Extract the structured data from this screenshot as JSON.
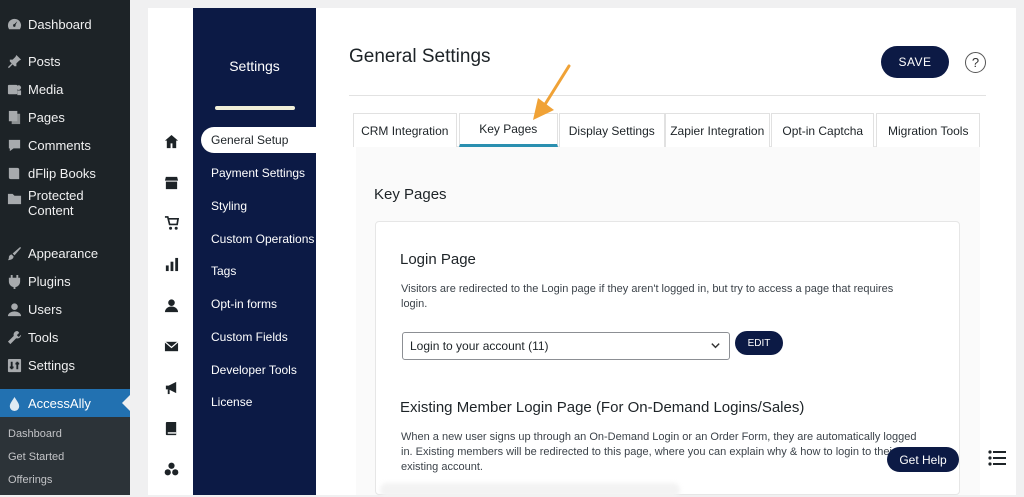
{
  "wp_menu": {
    "items": [
      {
        "label": "Dashboard",
        "icon": "dashboard-icon"
      },
      {
        "label": "Posts",
        "icon": "pin-icon"
      },
      {
        "label": "Media",
        "icon": "media-icon"
      },
      {
        "label": "Pages",
        "icon": "pages-icon"
      },
      {
        "label": "Comments",
        "icon": "comments-icon"
      },
      {
        "label": "dFlip Books",
        "icon": "book-icon"
      },
      {
        "label": "Protected Content",
        "icon": "folder-icon"
      },
      {
        "label": "Appearance",
        "icon": "brush-icon"
      },
      {
        "label": "Plugins",
        "icon": "plugin-icon"
      },
      {
        "label": "Users",
        "icon": "user-icon"
      },
      {
        "label": "Tools",
        "icon": "wrench-icon"
      },
      {
        "label": "Settings",
        "icon": "settings-icon"
      },
      {
        "label": "AccessAlly",
        "icon": "drop-icon"
      }
    ],
    "submenu": [
      "Dashboard",
      "Get Started",
      "Offerings"
    ]
  },
  "settings_nav": {
    "title": "Settings",
    "items": [
      "General Setup",
      "Payment Settings",
      "Styling",
      "Custom Operations",
      "Tags",
      "Opt-in forms",
      "Custom Fields",
      "Developer Tools",
      "License"
    ]
  },
  "header": {
    "title": "General Settings",
    "save_label": "SAVE",
    "help_label": "?"
  },
  "tabs": [
    "CRM Integration",
    "Key Pages",
    "Display Settings",
    "Zapier Integration",
    "Opt-in Captcha",
    "Migration Tools"
  ],
  "main": {
    "section_title": "Key Pages",
    "login": {
      "title": "Login Page",
      "description_line1": "Visitors are redirected to the Login page if they aren't logged in, but try to access a page that requires",
      "description_line2": "login.",
      "selected": "Login to your account (11)",
      "edit_label": "EDIT"
    },
    "existing": {
      "title": "Existing Member Login Page (For On-Demand Logins/Sales)",
      "description_line1": "When a new user signs up through an On-Demand Login or an Order Form, they are automatically logged",
      "description_line2": "in. Existing members will be redirected to this page, where you can explain why & how to login to their",
      "description_line3": "existing account."
    }
  },
  "help_widget": {
    "label": "Get Help"
  },
  "colors": {
    "navy": "#0c1a45",
    "wp_dark": "#1d2327",
    "accent_tab": "#2a8fb0",
    "arrow": "#f0a236",
    "wp_active": "#2271b1"
  }
}
